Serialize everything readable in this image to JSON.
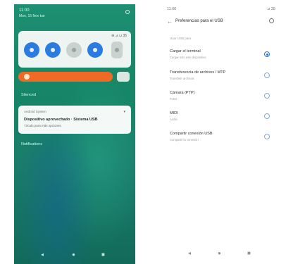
{
  "left_phone": {
    "status": {
      "time": "11:00",
      "date": "Mon, 15 Nov tue"
    },
    "quick_settings": {
      "status": "⊕ ⊿ ⊔ 35",
      "tiles": [
        {
          "icon": "wifi-icon",
          "state": "on"
        },
        {
          "icon": "bluetooth-icon",
          "state": "on"
        },
        {
          "icon": "flashlight-icon",
          "state": "off"
        },
        {
          "icon": "location-icon",
          "state": "on"
        },
        {
          "icon": "expand-icon",
          "state": "off"
        }
      ]
    },
    "sections": {
      "silent": "Silenced",
      "notifications": "Notifications"
    },
    "notification": {
      "app": "Android System",
      "title": "Dispositivo aprovechado · Sistema USB",
      "text": "Tócalo para más opciones"
    },
    "nav": {
      "back": "◂",
      "home": "●",
      "recents": "■"
    }
  },
  "right_phone": {
    "status": {
      "time": "11:00",
      "status": "⊿ 35"
    },
    "header": {
      "back": "←",
      "title": "Preferencias para el USB"
    },
    "section": "Usar USB para",
    "options": [
      {
        "label": "Cargar el terminal",
        "sub": "Cargar solo este dispositivo",
        "selected": true
      },
      {
        "label": "Transferencia de archivos / MTP",
        "sub": "Transferir archivos",
        "selected": false
      },
      {
        "label": "Cámara (PTP)",
        "sub": "Fotos",
        "selected": false
      },
      {
        "label": "MIDI",
        "sub": "Audio",
        "selected": false
      },
      {
        "label": "Compartir conexión USB",
        "sub": "Compartir la conexión",
        "selected": false
      }
    ],
    "nav": {
      "back": "◂",
      "home": "●",
      "recents": "■"
    }
  },
  "colors": {
    "accent_blue": "#2c7be0",
    "brightness_orange": "#f06a25",
    "wallpaper_green": "#168566"
  }
}
